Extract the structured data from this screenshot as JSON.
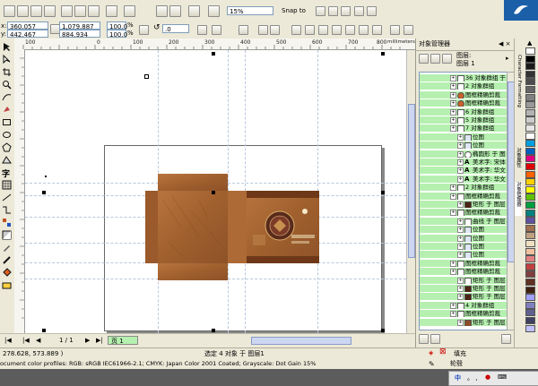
{
  "toolbar": {
    "zoom_value": "15%",
    "snap_to_label": "Snap to",
    "pos_x": "360.057 mm",
    "pos_y": "442.467 mm",
    "width": "1,079.887 mm",
    "height": "884.934 mm",
    "scale_x": "100.0",
    "scale_y": "100.0",
    "percent_symbol": "%",
    "rotation": ".0",
    "x_label": "x:",
    "y_label": "y:"
  },
  "ruler": {
    "h_numbers": [
      "100",
      "0",
      "100",
      "200",
      "300",
      "400",
      "500",
      "600",
      "700",
      "800",
      "900"
    ],
    "units": "millimeters"
  },
  "panel": {
    "title": "对象管理器",
    "layer_label": "图层:",
    "layer_name": "图层 1",
    "items": [
      {
        "indent": 0,
        "icon": "group",
        "text": "36 对象群组 于",
        "selected": true
      },
      {
        "indent": 0,
        "icon": "group",
        "text": "2 对象群组",
        "selected": true
      },
      {
        "indent": 0,
        "icon": "powerclip",
        "text": "图框精确剪裁",
        "selected": true
      },
      {
        "indent": 0,
        "icon": "powerclip",
        "text": "图框精确剪裁",
        "selected": true
      },
      {
        "indent": 0,
        "icon": "group",
        "text": "6 对象群组",
        "selected": true
      },
      {
        "indent": 0,
        "icon": "group",
        "text": "5 对象群组",
        "selected": true
      },
      {
        "indent": 0,
        "icon": "group",
        "text": "7 对象群组",
        "selected": true
      },
      {
        "indent": 1,
        "icon": "bitmap",
        "text": "位图",
        "selected": true
      },
      {
        "indent": 1,
        "icon": "bitmap",
        "text": "位图",
        "selected": true
      },
      {
        "indent": 1,
        "icon": "ellipse",
        "text": "椭圆形 于 图",
        "selected": true
      },
      {
        "indent": 1,
        "icon": "text",
        "text": "美术字: 宋体",
        "selected": true
      },
      {
        "indent": 1,
        "icon": "text",
        "text": "美术字: 华文",
        "selected": true
      },
      {
        "indent": 1,
        "icon": "text",
        "text": "美术字: 华文",
        "selected": true
      },
      {
        "indent": 0,
        "icon": "group",
        "text": "2 对象群组",
        "selected": true
      },
      {
        "indent": 0,
        "icon": "curve",
        "text": "图框精确剪裁",
        "selected": true
      },
      {
        "indent": 1,
        "icon": "rect-dark",
        "text": "矩形 于 图层",
        "selected": true
      },
      {
        "indent": 0,
        "icon": "curve",
        "text": "图框精确剪裁",
        "selected": true
      },
      {
        "indent": 1,
        "icon": "curve",
        "text": "曲线 于 图层",
        "selected": true
      },
      {
        "indent": 1,
        "icon": "bitmap",
        "text": "位图",
        "selected": true
      },
      {
        "indent": 1,
        "icon": "bitmap",
        "text": "位图",
        "selected": true
      },
      {
        "indent": 1,
        "icon": "bitmap",
        "text": "位图",
        "selected": true
      },
      {
        "indent": 1,
        "icon": "bitmap",
        "text": "位图",
        "selected": true
      },
      {
        "indent": 0,
        "icon": "rect",
        "text": "图框精确剪裁",
        "selected": true
      },
      {
        "indent": 0,
        "icon": "rect",
        "text": "图框精确剪裁",
        "selected": true
      },
      {
        "indent": 1,
        "icon": "rect",
        "text": "矩形 于 图层",
        "selected": true
      },
      {
        "indent": 1,
        "icon": "rect-dark",
        "text": "矩形 于 图层",
        "selected": true
      },
      {
        "indent": 1,
        "icon": "rect-dark",
        "text": "矩形 于 图层",
        "selected": true
      },
      {
        "indent": 0,
        "icon": "group",
        "text": "4 对象群组",
        "selected": true
      },
      {
        "indent": 0,
        "icon": "curve",
        "text": "图框精确剪裁",
        "selected": true
      },
      {
        "indent": 1,
        "icon": "rect-brown",
        "text": "矩形 于 图层",
        "selected": true
      }
    ]
  },
  "side_tabs": {
    "top": "Character Formatting",
    "mid1": "对象属性",
    "mid2": "对象管理器"
  },
  "palette": {
    "colors": [
      "#ffffff",
      "#000000",
      "#1a1a1a",
      "#333333",
      "#4d4d4d",
      "#666666",
      "#808080",
      "#999999",
      "#b3b3b3",
      "#cccccc",
      "#e6e6e6",
      "#ffffff",
      "#00a0e0",
      "#0060c0",
      "#e0007f",
      "#e00000",
      "#ff6000",
      "#ffd000",
      "#ffff00",
      "#60c000",
      "#00a040",
      "#008080",
      "#6050a0",
      "#a07050",
      "#c0a080",
      "#f0e0c0",
      "#f0c0a0",
      "#e08080",
      "#c04040",
      "#804040",
      "#603020",
      "#402010",
      "#a0a0ff",
      "#8080c0",
      "#606090",
      "#404060",
      "#c0c0ff"
    ]
  },
  "status": {
    "page_counter": "1 / 1",
    "page_tab": "页 1",
    "coords": "278.628, 573.889 )",
    "selection_info": "选定 4 对象 于 图层1",
    "fill_label": "填充",
    "outline_label": "轮毂",
    "color_profile": "ocument color profiles: RGB: sRGB IEC61966-2.1; CMYK: Japan Color 2001 Coated; Grayscale: Dot Gain 15%"
  },
  "taskbar": {
    "ime_label": "中",
    "ime_extra": "。 ,"
  },
  "colors": {
    "selected_row": "#b6f0b0",
    "ui_bg": "#ece9d8",
    "artwork_main": "#a4643a"
  }
}
